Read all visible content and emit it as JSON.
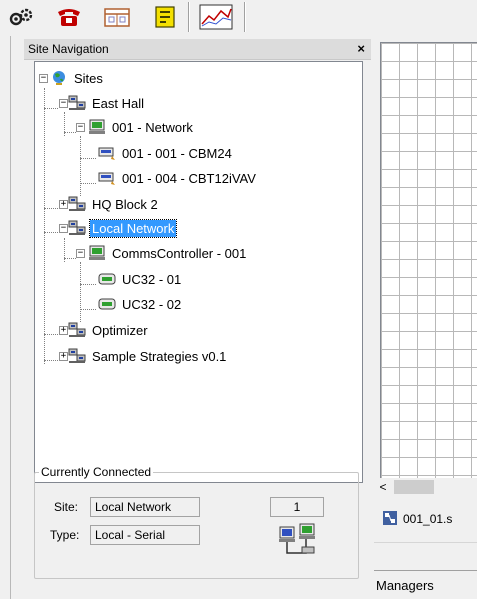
{
  "toolbar": {
    "buttons": [
      {
        "icon": "gears-icon",
        "label": ""
      },
      {
        "icon": "phone-icon",
        "label": ""
      },
      {
        "icon": "calendar-icon",
        "label": ""
      },
      {
        "icon": "document-icon",
        "label": ""
      },
      {
        "icon": "trend-graph-icon",
        "label": ""
      }
    ]
  },
  "nav": {
    "title": "Site Navigation",
    "close": "×",
    "tree": [
      {
        "label": "Sites",
        "icon": "globe-icon",
        "expander": "−"
      },
      {
        "label": "East Hall",
        "icon": "network-icon",
        "expander": "−"
      },
      {
        "label": "001 - Network",
        "icon": "controller-icon",
        "expander": "−"
      },
      {
        "label": "001 - 001 - CBM24",
        "icon": "device-icon"
      },
      {
        "label": "001 - 004 - CBT12iVAV",
        "icon": "device-icon"
      },
      {
        "label": "HQ Block 2",
        "icon": "network-icon",
        "expander": "+"
      },
      {
        "label": "Local Network",
        "icon": "network-icon",
        "expander": "−",
        "selected": true
      },
      {
        "label": "CommsController - 001",
        "icon": "controller-icon",
        "expander": "−"
      },
      {
        "label": "UC32 - 01",
        "icon": "unit-icon"
      },
      {
        "label": "UC32 - 02",
        "icon": "unit-icon"
      },
      {
        "label": "Optimizer",
        "icon": "network-icon",
        "expander": "+"
      },
      {
        "label": "Sample Strategies v0.1",
        "icon": "network-icon",
        "expander": "+"
      }
    ]
  },
  "connected": {
    "legend": "Currently Connected",
    "site_label": "Site:",
    "site_value": "Local Network",
    "site_number": "1",
    "type_label": "Type:",
    "type_value": "Local - Serial"
  },
  "right": {
    "scroll_left": "<",
    "doc_tab": "001_01.s",
    "managers": "Managers"
  }
}
